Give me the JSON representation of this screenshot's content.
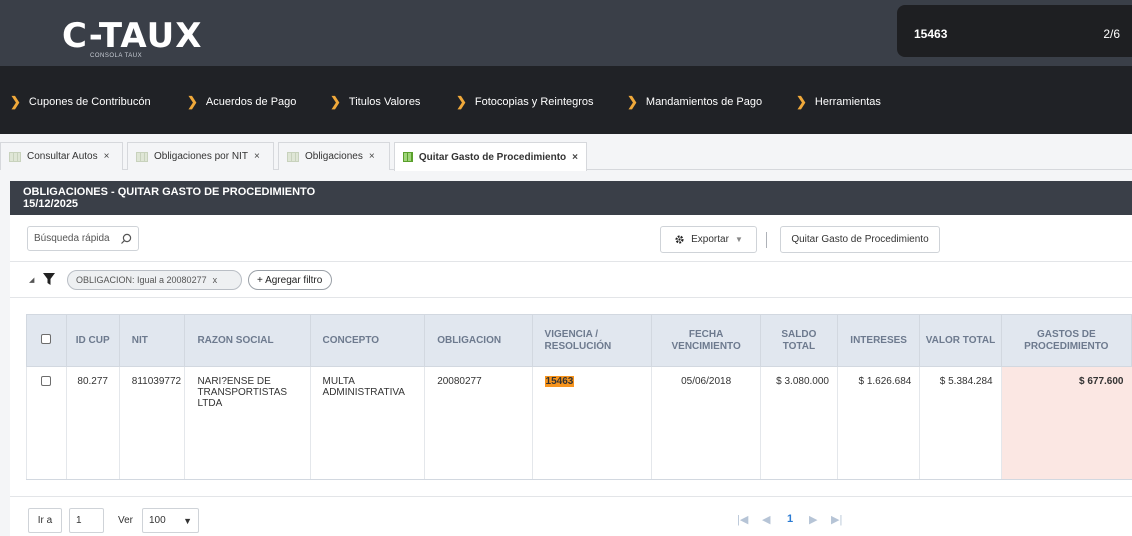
{
  "app": {
    "logo": "C-TAUX",
    "logo_sub": "CONSOLA TAUX"
  },
  "find": {
    "query": "15463",
    "count": "2/6"
  },
  "menu": [
    {
      "label": "Cupones de Contribucón"
    },
    {
      "label": "Acuerdos de Pago"
    },
    {
      "label": "Titulos Valores"
    },
    {
      "label": "Fotocopias y Reintegros"
    },
    {
      "label": "Mandamientos de Pago"
    },
    {
      "label": "Herramientas"
    }
  ],
  "tabs": [
    {
      "label": "Consultar Autos",
      "close": "×"
    },
    {
      "label": "Obligaciones por NIT",
      "close": "×"
    },
    {
      "label": "Obligaciones",
      "close": "×"
    },
    {
      "label": "Quitar Gasto de Procedimiento",
      "close": "×",
      "active": true
    }
  ],
  "panel": {
    "title": "OBLIGACIONES - QUITAR GASTO DE PROCEDIMIENTO",
    "date": "15/12/2025"
  },
  "toolbar": {
    "quick_search_placeholder": "Búsqueda rápida",
    "export_label": "Exportar",
    "action_label": "Quitar Gasto de Procedimiento"
  },
  "filters": {
    "chip": "OBLIGACION: Igual a 20080277",
    "chip_close": "x",
    "add_label": "+ Agregar filtro"
  },
  "table": {
    "headers": [
      "ID CUP",
      "NIT",
      "RAZON SOCIAL",
      "CONCEPTO",
      "OBLIGACION",
      "VIGENCIA / RESOLUCIÓN",
      "FECHA VENCIMIENTO",
      "SALDO TOTAL",
      "INTERESES",
      "VALOR TOTAL",
      "GASTOS DE PROCEDIMIENTO"
    ],
    "rows": [
      {
        "id_cup": "80.277",
        "nit": "811039772",
        "razon_social": "NARI?ENSE DE TRANSPORTISTAS LTDA",
        "concepto": "MULTA ADMINISTRATIVA",
        "obligacion": "20080277",
        "vigencia": "15463",
        "fecha_vencimiento": "05/06/2018",
        "saldo_total": "$ 3.080.000",
        "intereses": "$ 1.626.684",
        "valor_total": "$ 5.384.284",
        "gastos": "$ 677.600"
      }
    ]
  },
  "pager": {
    "goto_label": "Ir a",
    "page_value": "1",
    "view_label": "Ver",
    "page_size": "100",
    "current_page": "1"
  },
  "colors": {
    "highlight": "#f7941d",
    "accent_arrow": "#f0a93a",
    "header_bg": "#3a3f48",
    "gastos_bg": "#fbe7e3"
  }
}
